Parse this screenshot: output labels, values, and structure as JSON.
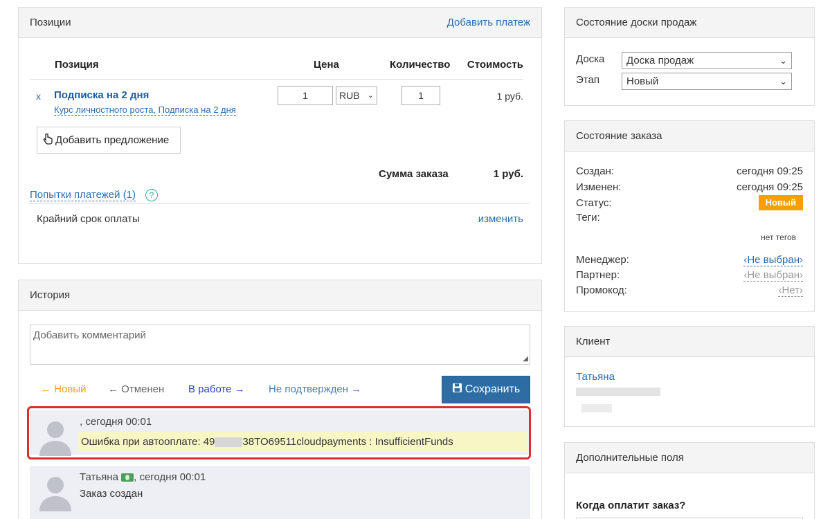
{
  "positions": {
    "title": "Позиции",
    "add_payment": "Добавить платеж",
    "columns": {
      "position": "Позиция",
      "price": "Цена",
      "quantity": "Количество",
      "cost": "Стоимость"
    },
    "item": {
      "remove": "x",
      "name": "Подписка на 2 дня",
      "subtitle": "Курс личностного роста, Подписка на 2 дня",
      "price": "1",
      "currency": "RUB",
      "quantity": "1",
      "cost": "1 руб."
    },
    "add_offer": "Добавить предложение",
    "sum_label": "Сумма заказа",
    "sum_value": "1 руб.",
    "payment_attempts": "Попытки платежей (1)",
    "help": "?",
    "deadline_label": "Крайний срок оплаты",
    "change": "изменить"
  },
  "history": {
    "title": "История",
    "comment_placeholder": "Добавить комментарий",
    "statuses": [
      "← Новый",
      "← Отменен",
      "В работе →",
      "Не подтвержден →"
    ],
    "save": "Сохранить",
    "events": [
      {
        "meta": ", сегодня 00:01",
        "msg_prefix": "Ошибка при автооплате: 49",
        "msg_suffix": "38TO69511cloudpayments : InsufficientFunds"
      },
      {
        "author": "Татьяна",
        "meta": ", сегодня 00:01",
        "msg": "Заказ создан"
      }
    ]
  },
  "board": {
    "title": "Состояние доски продаж",
    "board_label": "Доска",
    "board_value": "Доска продаж",
    "stage_label": "Этап",
    "stage_value": "Новый"
  },
  "order_state": {
    "title": "Состояние заказа",
    "created_label": "Создан:",
    "created_value": "сегодня 09:25",
    "changed_label": "Изменен:",
    "changed_value": "сегодня 09:25",
    "status_label": "Статус:",
    "status_value": "Новый",
    "tags_label": "Теги:",
    "tags_value": "нет тегов",
    "manager_label": "Менеджер:",
    "manager_value": "‹Не выбран›",
    "partner_label": "Партнер:",
    "partner_value": "‹Не выбран›",
    "promo_label": "Промокод:",
    "promo_value": "‹Нет›"
  },
  "client": {
    "title": "Клиент",
    "name": "Татьяна"
  },
  "extra_fields": {
    "title": "Дополнительные поля",
    "question": "Когда оплатит заказ?"
  },
  "colors": {
    "accent": "#2e6da4",
    "link": "#2b6cb0",
    "status_new": "#f5a000",
    "highlight": "#d9302b"
  }
}
